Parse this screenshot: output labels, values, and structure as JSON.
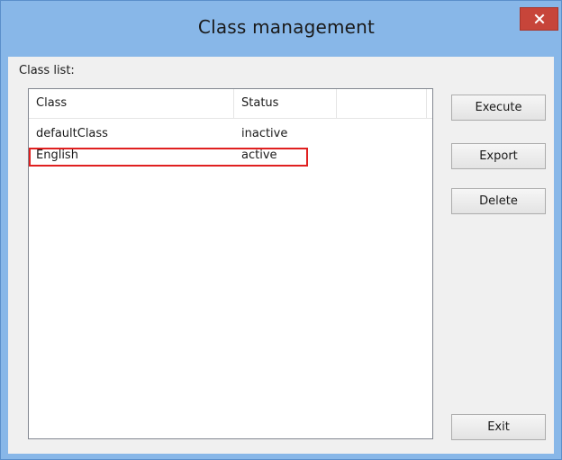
{
  "window": {
    "title": "Class management",
    "close_icon": "close-icon"
  },
  "class_list": {
    "label": "Class list:",
    "columns": [
      "Class",
      "Status"
    ],
    "rows": [
      {
        "class": "defaultClass",
        "status": "inactive"
      },
      {
        "class": "English",
        "status": "active",
        "highlighted": true
      }
    ]
  },
  "buttons": {
    "execute": "Execute",
    "export": "Export",
    "delete": "Delete",
    "exit": "Exit"
  },
  "colors": {
    "frame": "#88b7e8",
    "close_button": "#c7453a",
    "highlight": "#e02020"
  }
}
